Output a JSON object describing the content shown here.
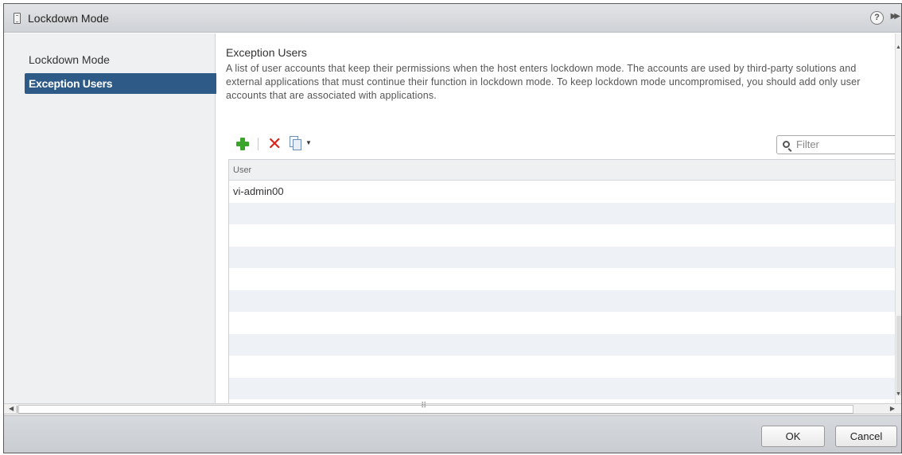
{
  "window": {
    "title": "Lockdown Mode",
    "help_label": "?"
  },
  "nav": {
    "items": [
      {
        "label": "Lockdown Mode",
        "selected": false
      },
      {
        "label": "Exception Users",
        "selected": true
      }
    ]
  },
  "section": {
    "title": "Exception Users",
    "description": "A list of user accounts that keep their permissions when the host enters lockdown mode. The accounts are used by third-party solutions and external applications that must continue their function in lockdown mode. To keep lockdown mode uncompromised, you should add only user accounts that are associated with applications."
  },
  "toolbar": {
    "add_icon": "add-icon",
    "remove_icon": "remove-icon",
    "copy_icon": "copy-icon",
    "filter_placeholder": "Filter"
  },
  "table": {
    "columns": [
      "User"
    ],
    "rows": [
      [
        "vi-admin00"
      ]
    ]
  },
  "footer": {
    "ok_label": "OK",
    "cancel_label": "Cancel"
  },
  "colors": {
    "selected_nav_bg": "#2e5a88",
    "add_icon": "#3aa52a",
    "remove_icon": "#d8261d",
    "alt_row": "#eef2f7"
  }
}
